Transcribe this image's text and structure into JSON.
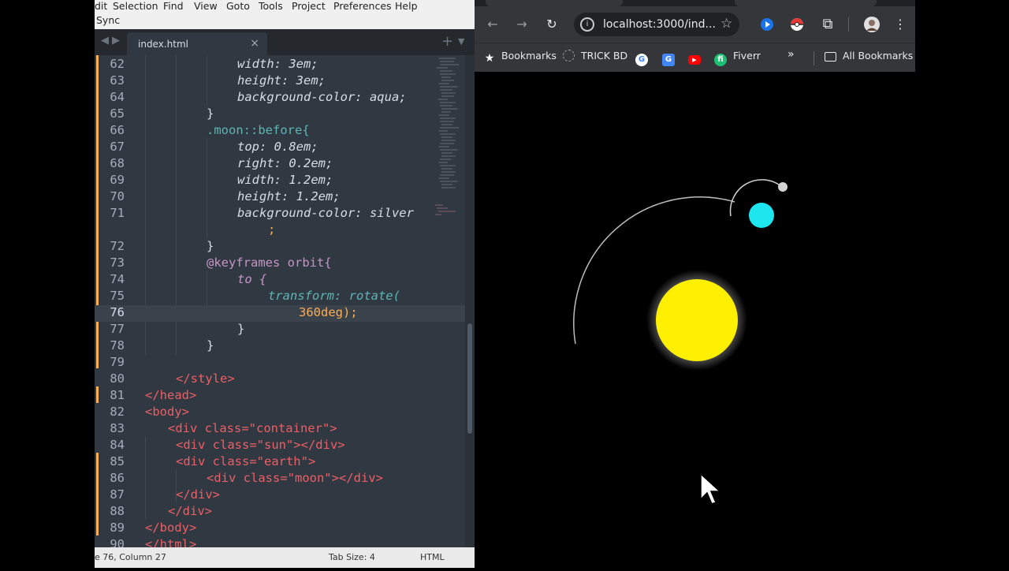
{
  "editor": {
    "menu": [
      "dit",
      "Selection",
      "Find",
      "View",
      "Goto",
      "Tools",
      "Project",
      "Preferences",
      "Help"
    ],
    "menu_row2": "Sync",
    "tab_label": "index.html",
    "tab_close": "×",
    "status": {
      "position": "e 76, Column 27",
      "tab_size": "Tab Size: 4",
      "syntax": "HTML"
    },
    "lines": [
      {
        "n": "62",
        "text": "width: 3em;"
      },
      {
        "n": "63",
        "text": "height: 3em;"
      },
      {
        "n": "64",
        "text": "background-color: aqua;"
      },
      {
        "n": "65",
        "text": "}"
      },
      {
        "n": "66",
        "text": ".moon::before{"
      },
      {
        "n": "67",
        "text": "top: 0.8em;"
      },
      {
        "n": "68",
        "text": "right: 0.2em;"
      },
      {
        "n": "69",
        "text": "width: 1.2em;"
      },
      {
        "n": "70",
        "text": "height: 1.2em;"
      },
      {
        "n": "71",
        "text": "background-color: silver"
      },
      {
        "n": "",
        "text": ";"
      },
      {
        "n": "72",
        "text": "}"
      },
      {
        "n": "73",
        "text": "@keyframes orbit{"
      },
      {
        "n": "74",
        "text": "to {"
      },
      {
        "n": "75",
        "text": "transform: rotate("
      },
      {
        "n": "76",
        "text": "360deg);"
      },
      {
        "n": "77",
        "text": "}"
      },
      {
        "n": "78",
        "text": "}"
      },
      {
        "n": "79",
        "text": ""
      },
      {
        "n": "80",
        "text": "</style>"
      },
      {
        "n": "81",
        "text": "</head>"
      },
      {
        "n": "82",
        "text": "<body>"
      },
      {
        "n": "83",
        "text": "<div class=\"container\">"
      },
      {
        "n": "84",
        "text": "<div class=\"sun\"></div>"
      },
      {
        "n": "85",
        "text": "<div class=\"earth\">"
      },
      {
        "n": "86",
        "text": "<div class=\"moon\"></div>"
      },
      {
        "n": "87",
        "text": "</div>"
      },
      {
        "n": "88",
        "text": "</div>"
      },
      {
        "n": "89",
        "text": "</body>"
      },
      {
        "n": "90",
        "text": "</html>"
      }
    ]
  },
  "browser": {
    "url": "localhost:3000/ind...",
    "bookmarks": [
      "Bookmarks",
      "TRICK BD",
      "Fiverr",
      "All Bookmarks"
    ],
    "colors": {
      "sun": "#ffef00",
      "earth": "#1ee6ef",
      "moon": "#c0c0c0"
    }
  }
}
